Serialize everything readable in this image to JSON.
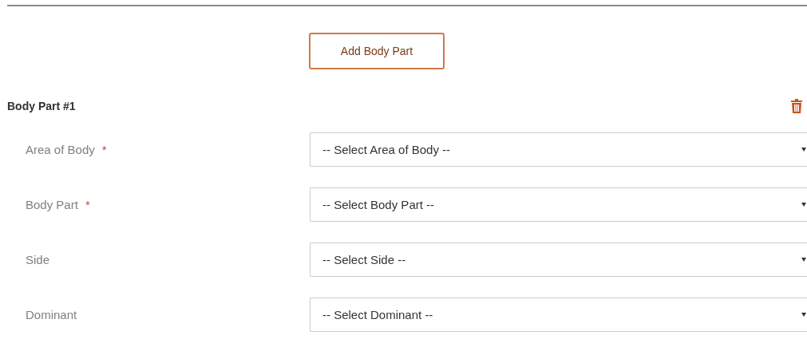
{
  "add_button": {
    "label": "Add Body Part"
  },
  "section": {
    "title": "Body Part #1"
  },
  "fields": [
    {
      "label": "Area of Body",
      "required_mark": "*",
      "placeholder": "-- Select Area of Body --"
    },
    {
      "label": "Body Part",
      "required_mark": "*",
      "placeholder": "-- Select Body Part --"
    },
    {
      "label": "Side",
      "placeholder": "-- Select Side --"
    },
    {
      "label": "Dominant",
      "placeholder": "-- Select Dominant --"
    }
  ]
}
